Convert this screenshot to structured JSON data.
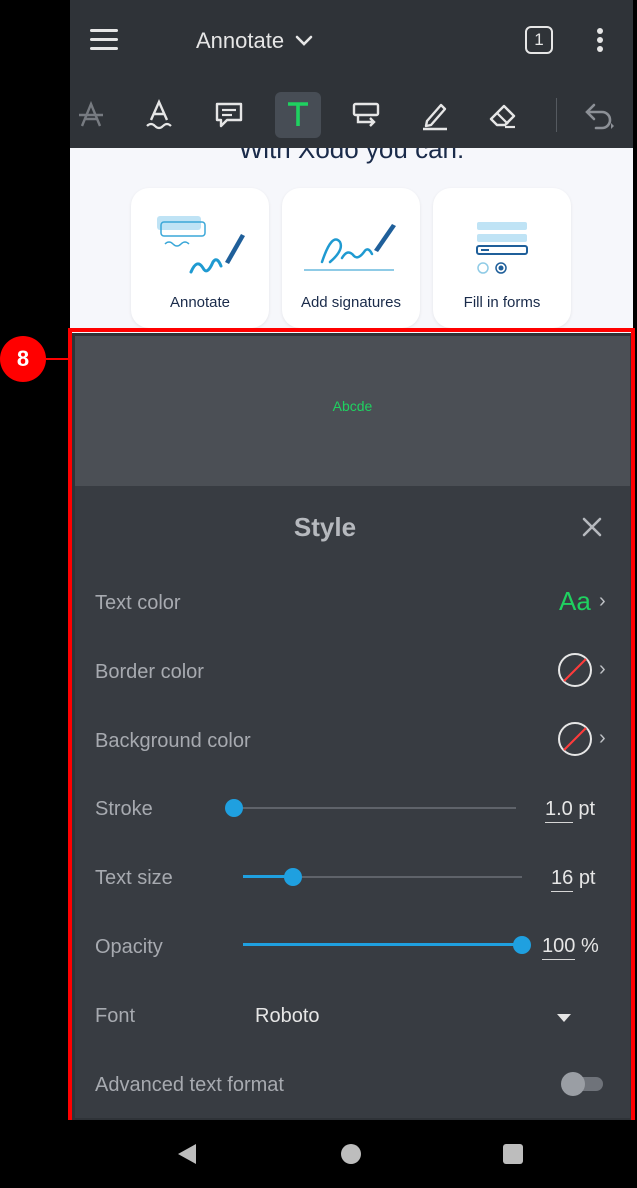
{
  "header": {
    "title": "Annotate",
    "page_count": "1"
  },
  "toolbar": {
    "tools": [
      "strikeout-icon",
      "underline-icon",
      "comment-icon",
      "free-text-icon",
      "callout-icon",
      "freehand-icon",
      "eraser-icon",
      "undo-icon"
    ],
    "active_tool": "free-text-icon"
  },
  "document": {
    "heading": "With Xodo you can:",
    "cards": [
      {
        "label": "Annotate"
      },
      {
        "label": "Add signatures"
      },
      {
        "label": "Fill in forms"
      }
    ]
  },
  "annotation": {
    "number": "8"
  },
  "style_panel": {
    "preview_text": "Abcde",
    "title": "Style",
    "text_color": {
      "label": "Text color",
      "swatch_text": "Aa",
      "color": "#1fd160"
    },
    "border_color": {
      "label": "Border color",
      "value": "none"
    },
    "background_color": {
      "label": "Background color",
      "value": "none"
    },
    "stroke": {
      "label": "Stroke",
      "value": "1.0",
      "unit": "pt",
      "level": 0
    },
    "text_size": {
      "label": "Text size",
      "value": "16",
      "unit": "pt",
      "level": 0.18
    },
    "opacity": {
      "label": "Opacity",
      "value": "100",
      "unit": "%",
      "level": 1.0
    },
    "font": {
      "label": "Font",
      "value": "Roboto"
    },
    "advanced_text_format": {
      "label": "Advanced text format",
      "enabled": false
    }
  },
  "colors": {
    "accent": "#1fa0e0",
    "text_green": "#1fd160",
    "highlight_red": "#ff0000"
  }
}
